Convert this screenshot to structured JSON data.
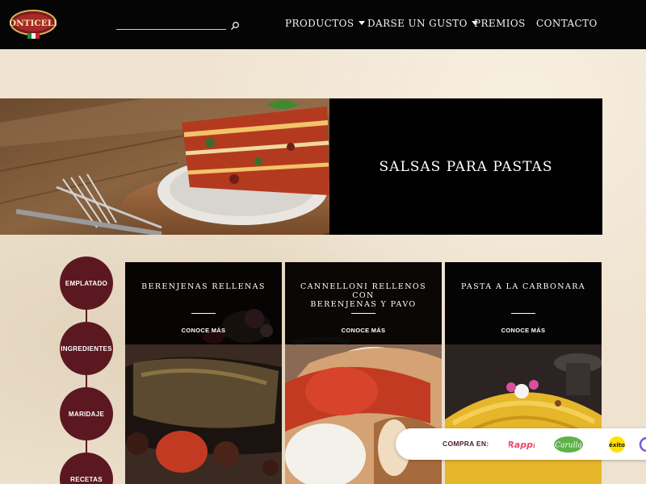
{
  "header": {
    "brand": "MONTICELLO",
    "search": {
      "placeholder": "",
      "value": ""
    },
    "nav": [
      {
        "label": "PRODUCTOS",
        "has_dropdown": true
      },
      {
        "label": "DARSE UN GUSTO",
        "has_dropdown": true
      },
      {
        "label": "PREMIOS",
        "has_dropdown": false
      },
      {
        "label": "CONTACTO",
        "has_dropdown": false
      }
    ]
  },
  "hero": {
    "title": "SALSAS PARA PASTAS"
  },
  "side_menu": [
    {
      "label": "EMPLATADO"
    },
    {
      "label": "INGREDIENTES"
    },
    {
      "label": "MARIDAJE"
    },
    {
      "label": "RECETAS"
    }
  ],
  "recipes": [
    {
      "title_lines": [
        "BERENJENAS RELLENAS"
      ],
      "link": "CONOCE MÁS"
    },
    {
      "title_lines": [
        "CANNELLONI RELLENOS CON",
        "BERENJENAS Y PAVO"
      ],
      "link": "CONOCE MÁS"
    },
    {
      "title_lines": [
        "PASTA A LA CARBONARA"
      ],
      "link": "CONOCE MÁS"
    }
  ],
  "buy": {
    "label": "COMPRA EN:",
    "stores": [
      "Rappi",
      "Carulla",
      "éxito"
    ]
  },
  "colors": {
    "header_bg": "#050505",
    "accent_wine": "#5c1820",
    "page_bg": "#efe3d0",
    "hero_panel": "#000000"
  }
}
